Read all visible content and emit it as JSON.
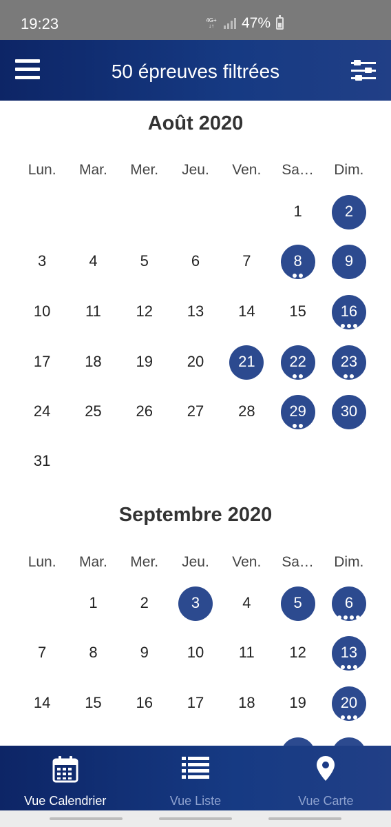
{
  "status_bar": {
    "time": "19:23",
    "network_top": "4G+",
    "network_bottom": "↓↑",
    "battery": "47%"
  },
  "app_bar": {
    "title": "50 épreuves filtrées",
    "menu_icon": "hamburger-menu-icon",
    "filter_icon": "filter-sliders-icon"
  },
  "weekdays": [
    "Lun.",
    "Mar.",
    "Mer.",
    "Jeu.",
    "Ven.",
    "Sa…",
    "Dim."
  ],
  "months": [
    {
      "title": "Août 2020",
      "weeks": [
        [
          null,
          null,
          null,
          null,
          null,
          {
            "d": "1"
          },
          {
            "d": "2",
            "e": true,
            "dots": 0
          }
        ],
        [
          {
            "d": "3"
          },
          {
            "d": "4"
          },
          {
            "d": "5"
          },
          {
            "d": "6"
          },
          {
            "d": "7"
          },
          {
            "d": "8",
            "e": true,
            "dots": 2
          },
          {
            "d": "9",
            "e": true,
            "dots": 0
          }
        ],
        [
          {
            "d": "10"
          },
          {
            "d": "11"
          },
          {
            "d": "12"
          },
          {
            "d": "13"
          },
          {
            "d": "14"
          },
          {
            "d": "15"
          },
          {
            "d": "16",
            "e": true,
            "dots": 3
          }
        ],
        [
          {
            "d": "17"
          },
          {
            "d": "18"
          },
          {
            "d": "19"
          },
          {
            "d": "20"
          },
          {
            "d": "21",
            "e": true,
            "dots": 0
          },
          {
            "d": "22",
            "e": true,
            "dots": 2
          },
          {
            "d": "23",
            "e": true,
            "dots": 2
          }
        ],
        [
          {
            "d": "24"
          },
          {
            "d": "25"
          },
          {
            "d": "26"
          },
          {
            "d": "27"
          },
          {
            "d": "28"
          },
          {
            "d": "29",
            "e": true,
            "dots": 2
          },
          {
            "d": "30",
            "e": true,
            "dots": 0
          }
        ],
        [
          {
            "d": "31"
          },
          null,
          null,
          null,
          null,
          null,
          null
        ]
      ]
    },
    {
      "title": "Septembre 2020",
      "weeks": [
        [
          null,
          {
            "d": "1"
          },
          {
            "d": "2"
          },
          {
            "d": "3",
            "e": true,
            "dots": 0
          },
          {
            "d": "4"
          },
          {
            "d": "5",
            "e": true,
            "dots": 0
          },
          {
            "d": "6",
            "e": true,
            "dots": 4
          }
        ],
        [
          {
            "d": "7"
          },
          {
            "d": "8"
          },
          {
            "d": "9"
          },
          {
            "d": "10"
          },
          {
            "d": "11"
          },
          {
            "d": "12"
          },
          {
            "d": "13",
            "e": true,
            "dots": 3
          }
        ],
        [
          {
            "d": "14"
          },
          {
            "d": "15"
          },
          {
            "d": "16"
          },
          {
            "d": "17"
          },
          {
            "d": "18"
          },
          {
            "d": "19"
          },
          {
            "d": "20",
            "e": true,
            "dots": 3
          }
        ],
        [
          null,
          null,
          null,
          null,
          null,
          {
            "d": "",
            "e": true,
            "dots": 0
          },
          {
            "d": "",
            "e": true,
            "dots": 0
          }
        ]
      ]
    }
  ],
  "bottom_nav": [
    {
      "label": "Vue Calendrier",
      "icon": "calendar-icon",
      "active": true
    },
    {
      "label": "Vue Liste",
      "icon": "list-icon",
      "active": false
    },
    {
      "label": "Vue Carte",
      "icon": "map-pin-icon",
      "active": false
    }
  ],
  "colors": {
    "event_circle": "#2c4a8f",
    "app_bar": "#163a83",
    "status_bar": "#7a7a7a"
  }
}
